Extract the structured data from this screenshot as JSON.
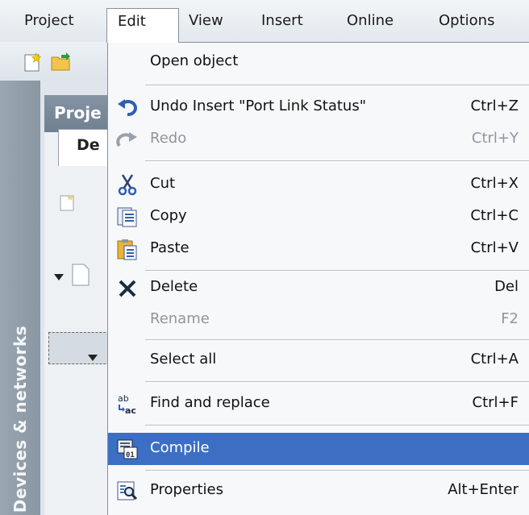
{
  "menubar": {
    "items": [
      "Project",
      "Edit",
      "View",
      "Insert",
      "Online",
      "Options"
    ]
  },
  "sidebar": {
    "vertical_tab_label": "Devices & networks"
  },
  "project_tree": {
    "header": "Proje",
    "tab": "De"
  },
  "edit_menu": {
    "items": [
      {
        "label": "Open object",
        "shortcut": "",
        "icon": "open-object",
        "enabled": true
      },
      {
        "label": "Undo Insert \"Port Link Status\"",
        "shortcut": "Ctrl+Z",
        "icon": "undo-icon",
        "enabled": true
      },
      {
        "label": "Redo",
        "shortcut": "Ctrl+Y",
        "icon": "redo-icon",
        "enabled": false
      },
      {
        "label": "Cut",
        "shortcut": "Ctrl+X",
        "icon": "scissors-icon",
        "enabled": true
      },
      {
        "label": "Copy",
        "shortcut": "Ctrl+C",
        "icon": "copy-icon",
        "enabled": true
      },
      {
        "label": "Paste",
        "shortcut": "Ctrl+V",
        "icon": "paste-icon",
        "enabled": true
      },
      {
        "label": "Delete",
        "shortcut": "Del",
        "icon": "delete-x-icon",
        "enabled": true
      },
      {
        "label": "Rename",
        "shortcut": "F2",
        "icon": "",
        "enabled": false
      },
      {
        "label": "Select all",
        "shortcut": "Ctrl+A",
        "icon": "",
        "enabled": true
      },
      {
        "label": "Find and replace",
        "shortcut": "Ctrl+F",
        "icon": "find-replace-icon",
        "enabled": true
      },
      {
        "label": "Compile",
        "shortcut": "",
        "icon": "compile-icon",
        "enabled": true,
        "highlighted": true
      },
      {
        "label": "Properties",
        "shortcut": "Alt+Enter",
        "icon": "properties-icon",
        "enabled": true
      }
    ]
  },
  "colors": {
    "highlight": "#3c6fc4",
    "menu_background": "#f6f8fa",
    "disabled_text": "#8f969e",
    "sidebar_tab": "#8a96a2"
  }
}
